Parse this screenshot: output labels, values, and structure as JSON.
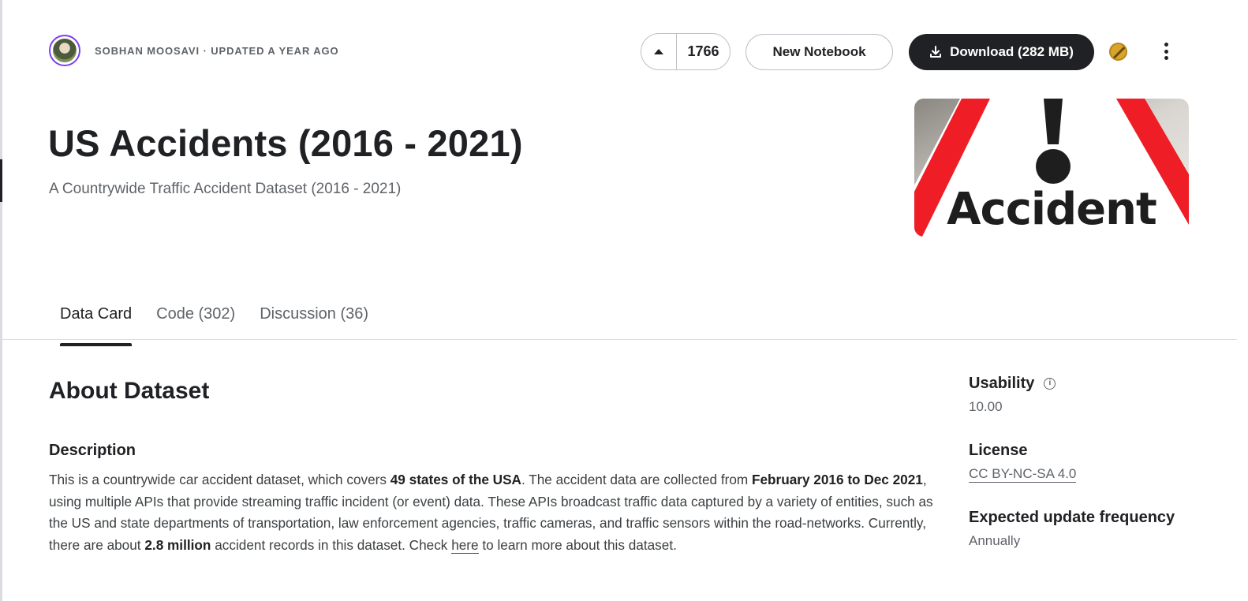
{
  "header": {
    "author_line": "SOBHAN MOOSAVI · UPDATED A YEAR AGO",
    "vote_count": "1766",
    "new_notebook_label": "New Notebook",
    "download_label": "Download (282 MB)"
  },
  "dataset": {
    "title": "US Accidents (2016 - 2021)",
    "subtitle": "A Countrywide Traffic Accident Dataset (2016 - 2021)",
    "cover_text": "Accident"
  },
  "tabs": [
    {
      "label": "Data Card"
    },
    {
      "label": "Code (302)"
    },
    {
      "label": "Discussion (36)"
    }
  ],
  "about": {
    "heading": "About Dataset",
    "description_heading": "Description",
    "description": {
      "p1": "This is a countrywide car accident dataset, which covers ",
      "b1": "49 states of the USA",
      "p2": ". The accident data are collected from ",
      "b2": "February 2016 to Dec 2021",
      "p3": ", using multiple APIs that provide streaming traffic incident (or event) data. These APIs broadcast traffic data captured by a variety of entities, such as the US and state departments of transportation, law enforcement agencies, traffic cameras, and traffic sensors within the road-networks. Currently, there are about ",
      "b3": "2.8 million",
      "p4": " accident records in this dataset. Check ",
      "link": "here",
      "p5": " to learn more about this dataset."
    }
  },
  "sidebar": {
    "usability_label": "Usability",
    "usability_value": "10.00",
    "license_label": "License",
    "license_value": "CC BY-NC-SA 4.0",
    "frequency_label": "Expected update frequency",
    "frequency_value": "Annually"
  },
  "icons": {
    "upvote": "caret-up-icon",
    "download": "download-icon",
    "medal": "medal-icon",
    "more": "more-vertical-icon",
    "info": "info-icon"
  },
  "colors": {
    "primary_button": "#202124",
    "avatar_ring": "#7b3ff2",
    "cover_red": "#ee1d26",
    "medal": "#d9a42b"
  }
}
